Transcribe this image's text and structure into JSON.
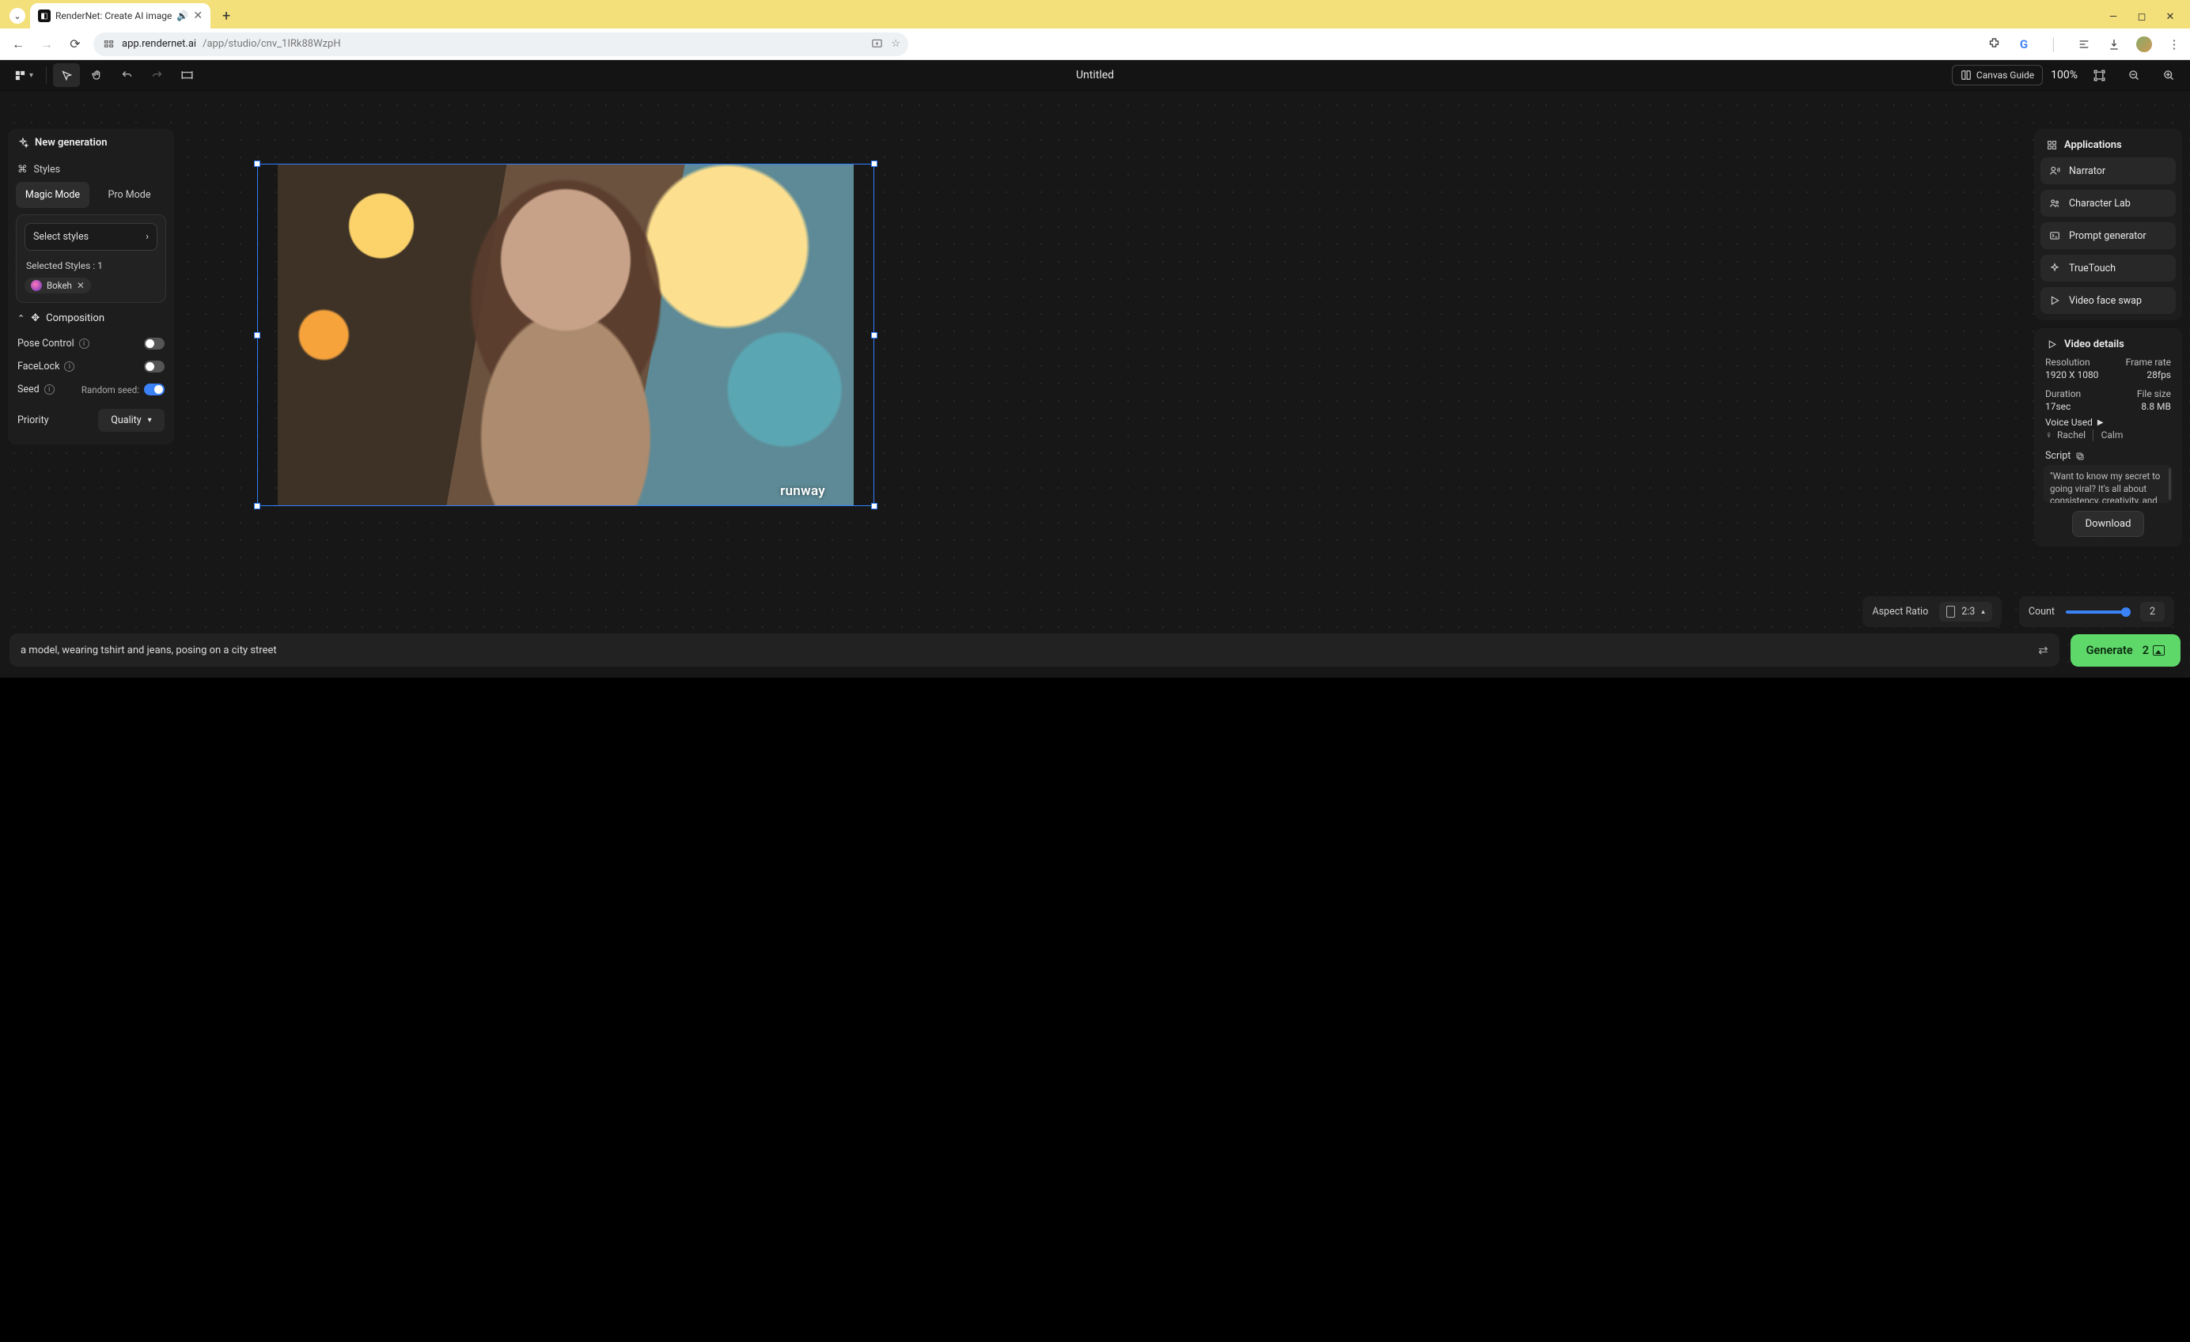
{
  "browser": {
    "tab_title": "RenderNet: Create AI image",
    "url_domain": "app.rendernet.ai",
    "url_path": "/app/studio/cnv_1IRk88WzpH"
  },
  "topbar": {
    "doc_title": "Untitled",
    "guide_label": "Canvas Guide",
    "zoom": "100%"
  },
  "left": {
    "title": "New generation",
    "styles_label": "Styles",
    "mode_tabs": [
      "Magic Mode",
      "Pro Mode"
    ],
    "select_styles": "Select styles",
    "selected_label": "Selected Styles : 1",
    "chip": "Bokeh",
    "composition": "Composition",
    "pose": "Pose Control",
    "facelock": "FaceLock",
    "seed": "Seed",
    "random_seed": "Random seed:",
    "priority_label": "Priority",
    "priority_value": "Quality"
  },
  "right": {
    "apps_title": "Applications",
    "apps": [
      "Narrator",
      "Character Lab",
      "Prompt generator",
      "TrueTouch",
      "Video face swap"
    ],
    "video_title": "Video details",
    "resolution_k": "Resolution",
    "resolution_v": "1920 X 1080",
    "framerate_k": "Frame rate",
    "framerate_v": "28fps",
    "duration_k": "Duration",
    "duration_v": "17sec",
    "filesize_k": "File size",
    "filesize_v": "8.8 MB",
    "voice_used": "Voice Used",
    "voice_name": "Rachel",
    "voice_mood": "Calm",
    "script_label": "Script",
    "script_text": "\"Want to know my secret to going viral? It's all about consistency, creativity, and engaging with your",
    "download": "Download"
  },
  "canvas": {
    "watermark": "runway"
  },
  "bottom": {
    "aspect_label": "Aspect Ratio",
    "aspect_value": "2:3",
    "count_label": "Count",
    "count_value": "2",
    "prompt": "a model, wearing tshirt and jeans, posing on a city street",
    "generate": "Generate",
    "generate_count": "2"
  }
}
